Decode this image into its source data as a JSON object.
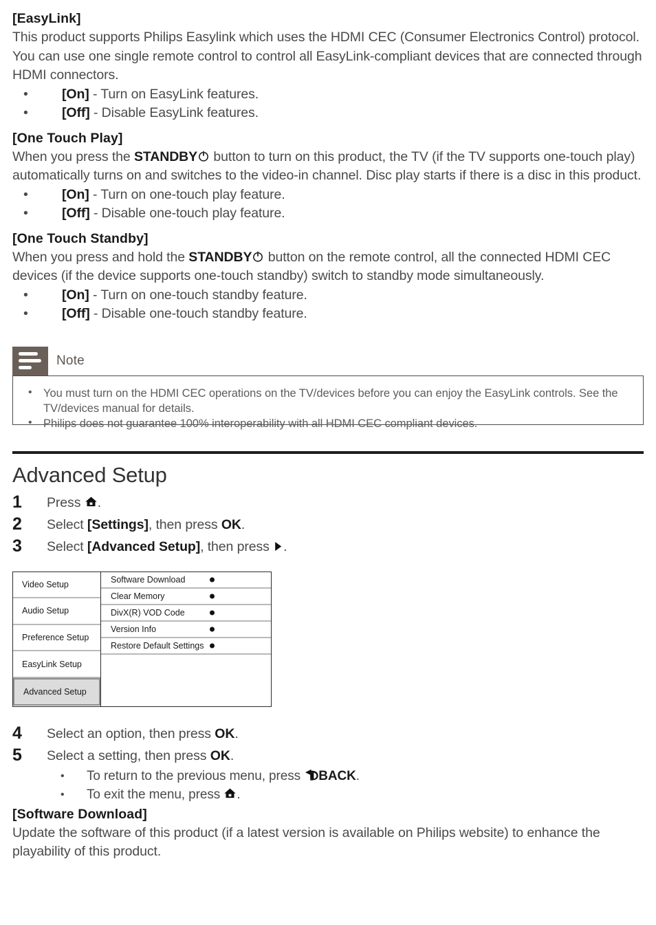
{
  "easylink": {
    "heading": "[EasyLink]",
    "body_1": "This product supports Philips Easylink which uses the HDMI CEC (Consumer Electronics Control) protocol. You can use one single remote control to control all EasyLink-compliant devices that are connected through HDMI connectors.",
    "options": [
      {
        "label": "[On]",
        "desc": " - Turn on EasyLink features."
      },
      {
        "label": "[Off]",
        "desc": " - Disable EasyLink features."
      }
    ]
  },
  "one_touch_play": {
    "heading": "[One Touch Play]",
    "body_a": "When you press the ",
    "body_key": "STANDBY",
    "body_b": " button to turn on this product, the TV (if the TV supports one-touch play) automatically turns on and switches to the video-in channel. Disc play starts if there is a disc in this product.",
    "options": [
      {
        "label": "[On]",
        "desc": " - Turn on one-touch play feature."
      },
      {
        "label": "[Off]",
        "desc": " - Disable one-touch play feature."
      }
    ]
  },
  "one_touch_standby": {
    "heading": "[One Touch Standby]",
    "body_a": "When you press and hold the ",
    "body_key": "STANDBY",
    "body_b": " button on the remote control, all the connected HDMI CEC devices (if the device supports one-touch standby) switch to standby mode simultaneously.",
    "options": [
      {
        "label": "[On]",
        "desc": " - Turn on one-touch standby feature."
      },
      {
        "label": "[Off]",
        "desc": " - Disable one-touch standby feature."
      }
    ]
  },
  "note": {
    "title": "Note",
    "items": [
      "You must turn on the HDMI CEC operations on the TV/devices before you can enjoy the EasyLink controls. See the TV/devices manual for details.",
      "Philips does not guarantee 100% interoperability with all HDMI CEC compliant devices."
    ]
  },
  "advanced_setup": {
    "title": "Advanced Setup",
    "steps": [
      {
        "num": "1",
        "pre": "Press ",
        "icon": "home-icon",
        "post": "."
      },
      {
        "num": "2",
        "pre": "Select ",
        "bold": "[Settings]",
        "mid": ", then press ",
        "bold2": "OK",
        "post": "."
      },
      {
        "num": "3",
        "pre": "Select ",
        "bold": "[Advanced Setup]",
        "mid": ", then press ",
        "icon": "play-right-icon",
        "post": "."
      },
      {
        "num": "4",
        "pre": "Select an option, then press ",
        "bold2": "OK",
        "post": "."
      },
      {
        "num": "5",
        "pre": "Select a setting, then press ",
        "bold2": "OK",
        "post": "."
      }
    ],
    "sub_bullets": [
      {
        "pre": "To return to the previous menu, press ",
        "icon": "back-arrow-icon",
        "bold": "BACK",
        "post": "."
      },
      {
        "pre": "To exit the menu, press ",
        "icon": "home-icon",
        "post": "."
      }
    ]
  },
  "osd_menu": {
    "left_items": [
      {
        "label": "Video Setup",
        "selected": false
      },
      {
        "label": "Audio Setup",
        "selected": false
      },
      {
        "label": "Preference Setup",
        "selected": false
      },
      {
        "label": "EasyLink Setup",
        "selected": false
      },
      {
        "label": "Advanced Setup",
        "selected": true
      }
    ],
    "right_items": [
      "Software Download",
      "Clear Memory",
      "DivX(R) VOD Code",
      "Version Info",
      "Restore Default Settings"
    ]
  },
  "software_download": {
    "heading": "[Software Download]",
    "body": "Update the software of this product (if a latest version is available on Philips website) to enhance the playability of this product."
  },
  "colors": {
    "note_icon_bg": "#6b6058",
    "rule": "#1d1d1d",
    "selected_menu_bg": "#dcdcdc",
    "menu_divider": "#b9b9b9"
  }
}
